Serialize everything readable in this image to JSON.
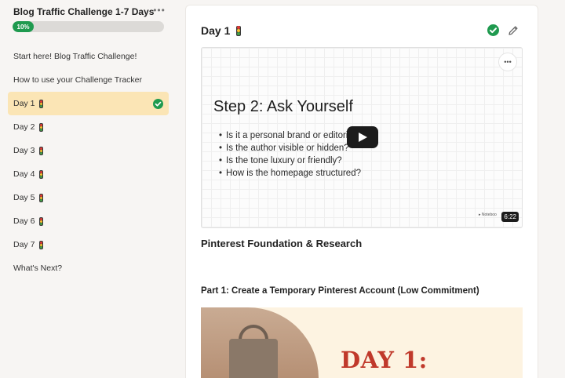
{
  "sidebar": {
    "course_title": "Blog Traffic Challenge 1-7 Days",
    "more_icon": "ellipsis-icon",
    "progress_label": "10%",
    "progress_fraction": 0.14,
    "items": [
      {
        "label": "Start here! Blog Traffic Challenge!"
      },
      {
        "label": "How to use your Challenge Tracker"
      },
      {
        "label": "Day 1",
        "emoji": "traffic-light-icon",
        "active": true,
        "completed": true
      },
      {
        "label": "Day 2",
        "emoji": "traffic-light-icon"
      },
      {
        "label": "Day 3",
        "emoji": "traffic-light-icon"
      },
      {
        "label": "Day 4",
        "emoji": "traffic-light-icon"
      },
      {
        "label": "Day 5",
        "emoji": "traffic-light-icon"
      },
      {
        "label": "Day 6",
        "emoji": "traffic-light-icon"
      },
      {
        "label": "Day 7",
        "emoji": "traffic-light-icon"
      },
      {
        "label": "What's Next?"
      }
    ]
  },
  "lesson": {
    "title": "Day 1",
    "complete_icon": "check-circle-icon",
    "edit_icon": "pencil-icon",
    "video": {
      "slide_title": "Step 2: Ask Yourself",
      "bullets": [
        "Is it a personal brand or editorial?",
        "Is the author visible or hidden?",
        "Is the tone luxury or friendly?",
        "How is the homepage structured?"
      ],
      "watermark": "Noteboo",
      "duration": "6:22",
      "more_icon": "ellipsis-icon",
      "play_icon": "play-icon"
    },
    "section_title": "Pinterest Foundation & Research",
    "part_title": "Part 1: Create a Temporary Pinterest Account (Low Commitment)",
    "banner_text": "DAY 1:"
  },
  "colors": {
    "accent_green": "#1f9a4f",
    "active_item_bg": "#fbe5b5",
    "banner_red": "#c0392b"
  }
}
